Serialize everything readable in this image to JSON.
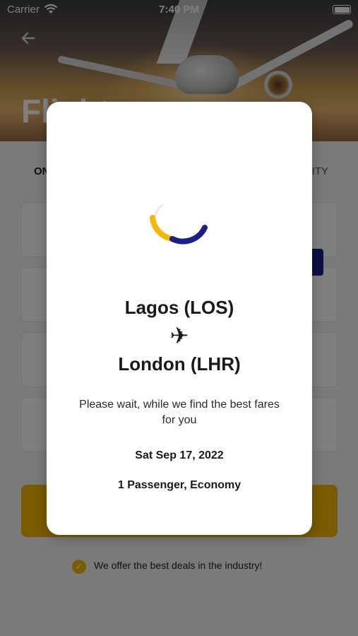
{
  "status_bar": {
    "carrier": "Carrier",
    "time": "7:40 PM",
    "wifi_icon": "wifi-icon",
    "battery_icon": "battery-icon"
  },
  "header": {
    "back_icon": "back-arrow-icon",
    "title": "Flights"
  },
  "tabs": {
    "left_label": "ONE WAY",
    "right_label": "MULTI-CITY"
  },
  "footer": {
    "deal_text": "We offer the best deals in the industry!",
    "check_icon": "check-icon"
  },
  "modal": {
    "origin": "Lagos (LOS)",
    "plane_glyph": "✈",
    "plane_icon": "airplane-icon",
    "destination": "London (LHR)",
    "wait_message": "Please wait, while we find the best fares for you",
    "date": "Sat Sep 17, 2022",
    "passengers": "1 Passenger, Economy"
  },
  "colors": {
    "accent_yellow": "#f5b700",
    "accent_navy": "#1b1f8a",
    "overlay": "rgba(0,0,0,0.5)"
  }
}
